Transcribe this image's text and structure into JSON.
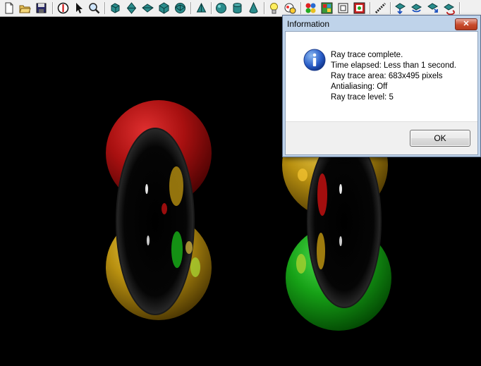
{
  "toolbar": {
    "buttons": [
      {
        "name": "new-file-icon"
      },
      {
        "name": "open-folder-icon"
      },
      {
        "name": "save-icon"
      },
      {
        "name": "stop-icon"
      },
      {
        "name": "pointer-icon"
      },
      {
        "name": "zoom-icon"
      },
      {
        "name": "cube-icon"
      },
      {
        "name": "octahedron-icon"
      },
      {
        "name": "diamond-icon"
      },
      {
        "name": "polyhedron-icon"
      },
      {
        "name": "geodesic-icon"
      },
      {
        "name": "pyramid-icon"
      },
      {
        "name": "sphere-icon"
      },
      {
        "name": "cylinder-icon"
      },
      {
        "name": "cone-icon"
      },
      {
        "name": "light-bulb-icon"
      },
      {
        "name": "texture-icon"
      },
      {
        "name": "spheres-icon"
      },
      {
        "name": "image-icon"
      },
      {
        "name": "frame-icon"
      },
      {
        "name": "render-icon"
      },
      {
        "name": "ray-trace-icon"
      },
      {
        "name": "move-icon"
      },
      {
        "name": "rotate-icon"
      },
      {
        "name": "scale-icon"
      },
      {
        "name": "transform-icon"
      }
    ]
  },
  "dialog": {
    "title": "Information",
    "close_label": "✕",
    "icon": "info-icon",
    "lines": [
      "Ray trace complete.",
      "Time elapsed: Less than 1 second.",
      "Ray trace area: 683x495 pixels",
      "Antialiasing: Off",
      "Ray trace level: 5"
    ],
    "ok_label": "OK"
  },
  "colors": {
    "background": "#000000",
    "red_sphere": "#b01010",
    "yellow_sphere": "#c8a010",
    "green_sphere": "#18a018"
  }
}
